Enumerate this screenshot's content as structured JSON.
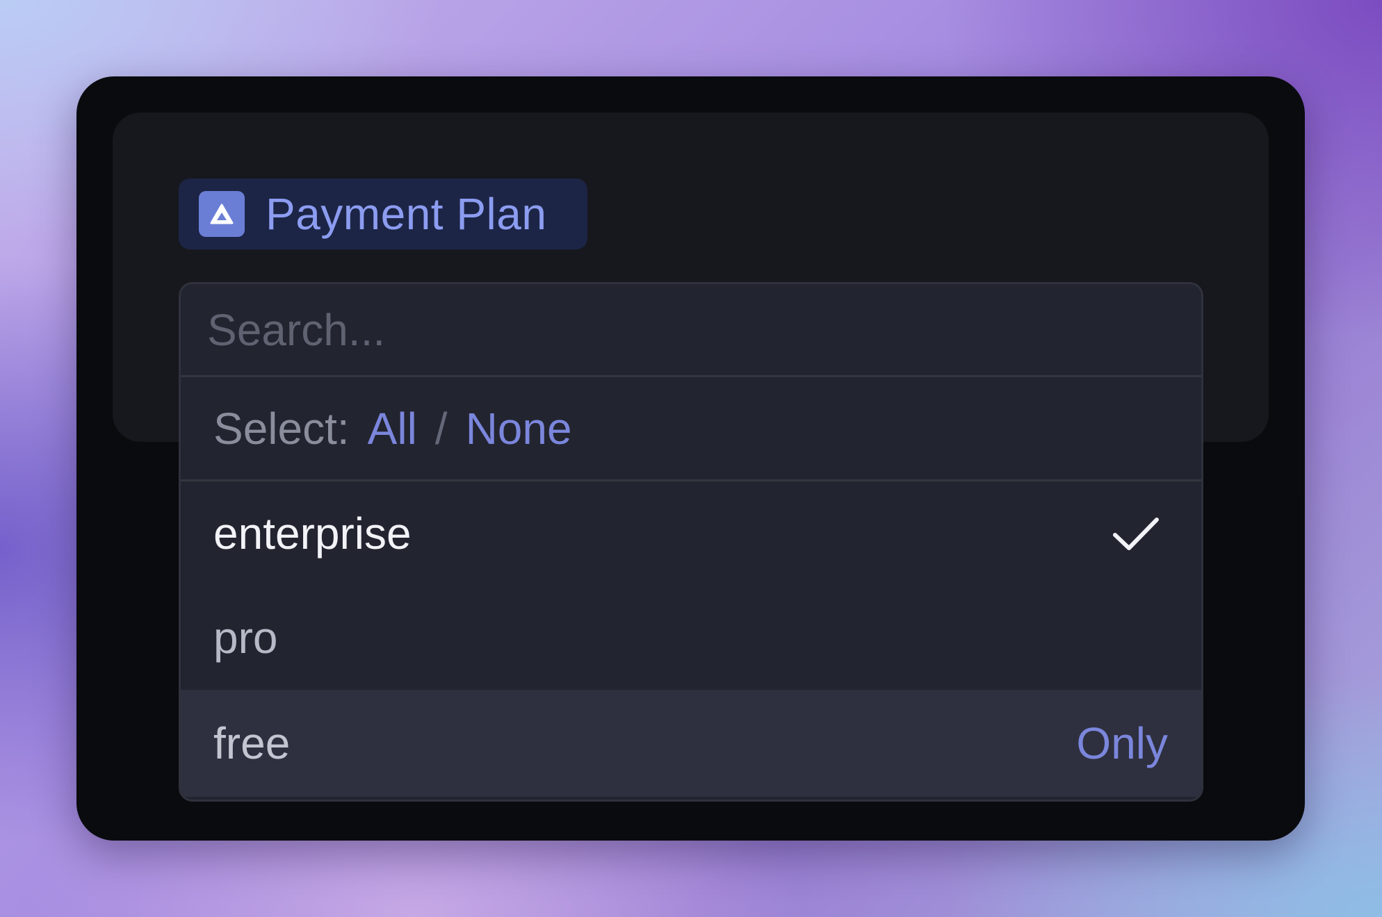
{
  "filter": {
    "chip_label": "Payment Plan",
    "chip_icon": "triangle-icon"
  },
  "dropdown": {
    "search_placeholder": "Search...",
    "select_label": "Select:",
    "select_all": "All",
    "select_separator": "/",
    "select_none": "None",
    "options": [
      {
        "label": "enterprise",
        "checked": true
      },
      {
        "label": "pro",
        "checked": false
      },
      {
        "label": "free",
        "checked": false,
        "hovered": true,
        "action": "Only"
      }
    ]
  },
  "colors": {
    "accent": "#7b86dc",
    "chip_background": "#1c2546",
    "window_background": "#0a0b0e",
    "dropdown_background": "#222430",
    "hover_background": "#2e303f"
  }
}
